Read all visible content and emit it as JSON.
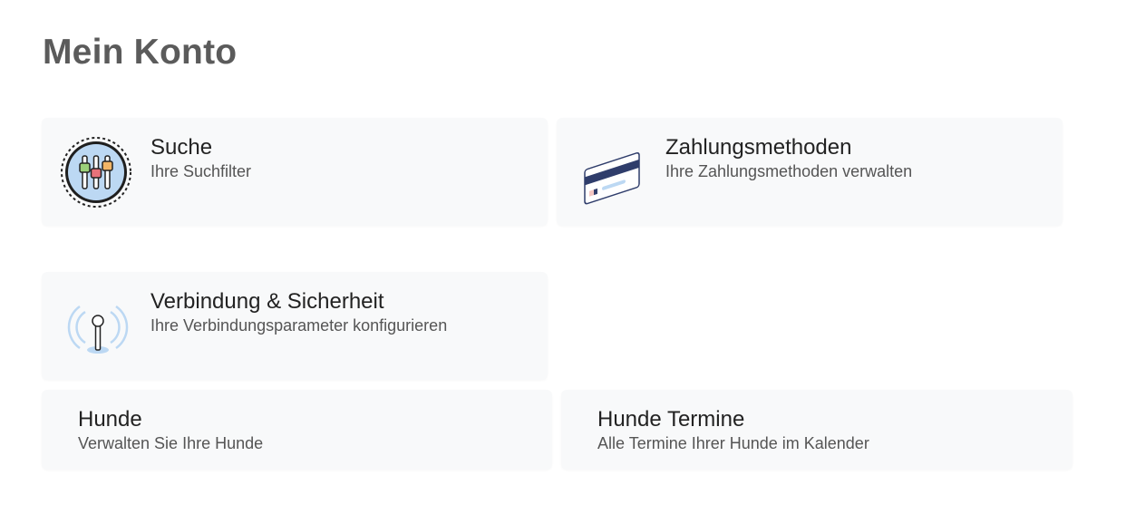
{
  "page": {
    "title": "Mein Konto"
  },
  "cards": [
    {
      "title": "Suche",
      "subtitle": "Ihre Suchfilter",
      "icon": "search-filter-sliders-icon"
    },
    {
      "title": "Zahlungsmethoden",
      "subtitle": "Ihre Zahlungsmethoden verwalten",
      "icon": "credit-card-icon"
    },
    {
      "title": "Verbindung & Sicherheit",
      "subtitle": "Ihre Verbindungsparameter konfigurieren",
      "icon": "antenna-signal-icon"
    },
    {
      "title": "Hunde",
      "subtitle": "Verwalten Sie Ihre Hunde"
    },
    {
      "title": "Hunde Termine",
      "subtitle": "Alle Termine Ihrer Hunde im Kalender"
    }
  ],
  "colors": {
    "card_background": "#f8f9fa",
    "title_text": "#5b5b5b",
    "card_title_text": "#222222",
    "card_subtitle_text": "#555555",
    "icon_navy": "#2f3d6b",
    "icon_light_blue": "#bcd8f3"
  }
}
